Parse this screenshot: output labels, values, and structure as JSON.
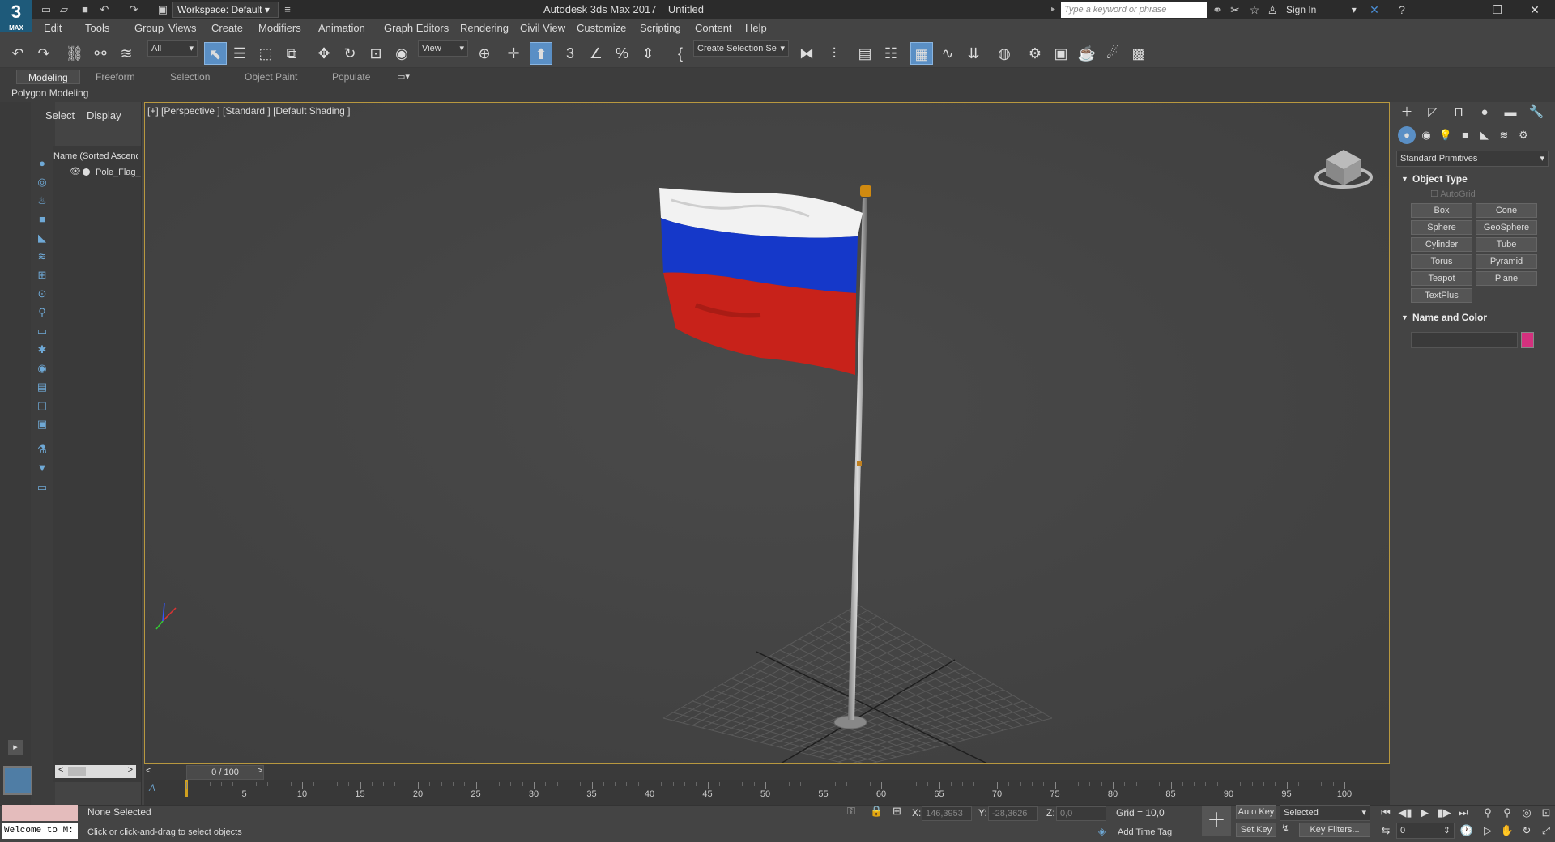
{
  "app": {
    "title": "Autodesk 3ds Max 2017",
    "document": "Untitled",
    "logo_number": "3",
    "logo_text": "MAX"
  },
  "workspace": {
    "label": "Workspace: Default"
  },
  "search": {
    "placeholder": "Type a keyword or phrase"
  },
  "account": {
    "sign_in": "Sign In"
  },
  "menus": [
    "Edit",
    "Tools",
    "Group",
    "Views",
    "Create",
    "Modifiers",
    "Animation",
    "Graph Editors",
    "Rendering",
    "Civil View",
    "Customize",
    "Scripting",
    "Content",
    "Help"
  ],
  "toolbar": {
    "selection_filter": "All",
    "reference_coord": "View",
    "named_selection": "Create Selection Se"
  },
  "ribbon": {
    "tabs": [
      "Modeling",
      "Freeform",
      "Selection",
      "Object Paint",
      "Populate"
    ],
    "active_tab": "Modeling",
    "sub_label": "Polygon Modeling"
  },
  "scene_explorer": {
    "tabs": [
      "Select",
      "Display"
    ],
    "column_header": "Name (Sorted Ascending)",
    "items": [
      "Pole_Flag_"
    ]
  },
  "viewport": {
    "label": "[+] [Perspective ] [Standard ] [Default Shading ]"
  },
  "command_panel": {
    "category": "Standard Primitives",
    "object_type_title": "Object Type",
    "autogrid_label": "AutoGrid",
    "primitives": [
      "Box",
      "Cone",
      "Sphere",
      "GeoSphere",
      "Cylinder",
      "Tube",
      "Torus",
      "Pyramid",
      "Teapot",
      "Plane",
      "TextPlus"
    ],
    "name_color_title": "Name and Color",
    "object_color": "#d4317e"
  },
  "timeline": {
    "frame_label": "0 / 100",
    "ticks": [
      "0",
      "5",
      "10",
      "15",
      "20",
      "25",
      "30",
      "35",
      "40",
      "45",
      "50",
      "55",
      "60",
      "65",
      "70",
      "75",
      "80",
      "85",
      "90",
      "95",
      "100"
    ]
  },
  "status": {
    "maxscript_output": "Welcome to M:",
    "selection": "None Selected",
    "prompt": "Click or click-and-drag to select objects",
    "x_label": "X:",
    "x_value": "146,3953",
    "y_label": "Y:",
    "y_value": "-28,3626",
    "z_label": "Z:",
    "z_value": "0,0",
    "grid": "Grid = 10,0",
    "add_time_tag": "Add Time Tag",
    "auto_key": "Auto Key",
    "set_key": "Set Key",
    "key_mode": "Selected",
    "key_filters": "Key Filters...",
    "current_frame": "0"
  },
  "colors": {
    "accent": "#5a8fc5",
    "viewport_border": "#b8983f",
    "flag_white": "#f2f2f2",
    "flag_blue": "#1538c9",
    "flag_red": "#c8221a"
  }
}
